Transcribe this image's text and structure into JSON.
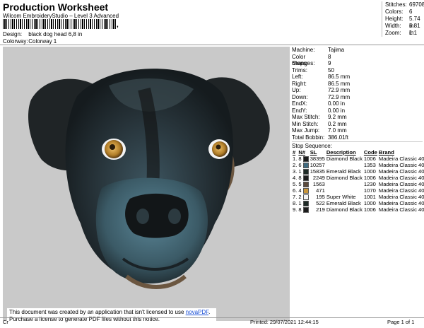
{
  "header": {
    "title": "Production Worksheet",
    "subtitle": "Wilcom EmbroideryStudio – Level 3 Advanced",
    "barcode_suffix": ",",
    "design_label": "Design:",
    "design_value": "black dog head 6,8 in",
    "colorway_label": "Colorway:",
    "colorway_value": "Colorway 1"
  },
  "stats": [
    {
      "label": "Stitches:",
      "value": "69708"
    },
    {
      "label": "Colors:",
      "value": "6"
    },
    {
      "label": "Height:",
      "value": "5.74 in"
    },
    {
      "label": "Width:",
      "value": "6.81 in"
    },
    {
      "label": "Zoom:",
      "value": "1:1"
    }
  ],
  "machine": [
    {
      "label": "Machine:",
      "value": "Tajima"
    },
    {
      "label": "Color changes:",
      "value": "8"
    },
    {
      "label": "Stops:",
      "value": "9"
    },
    {
      "label": "Trims:",
      "value": "50"
    },
    {
      "label": "Left:",
      "value": "86.5 mm"
    },
    {
      "label": "Right:",
      "value": "86.5 mm"
    },
    {
      "label": "Up:",
      "value": "72.9 mm"
    },
    {
      "label": "Down:",
      "value": "72.9 mm"
    },
    {
      "label": "EndX:",
      "value": "0.00 in"
    },
    {
      "label": "EndY:",
      "value": "0.00 in"
    },
    {
      "label": "Max Stitch:",
      "value": "9.2 mm"
    },
    {
      "label": "Min Stitch:",
      "value": "0.2 mm"
    },
    {
      "label": "Max Jump:",
      "value": "7.0 mm"
    },
    {
      "label": "Total Bobbin:",
      "value": "386.01ft"
    }
  ],
  "stop_sequence": {
    "title": "Stop Sequence:",
    "columns": [
      "#",
      "N#",
      "SL",
      "Description",
      "Code",
      "Brand"
    ],
    "rows": [
      {
        "num": "1.",
        "n": "8",
        "color": "#1c1c1c",
        "sl": "38395",
        "desc": "Diamond Black",
        "code": "1006",
        "brand": "Madeira Classic 40"
      },
      {
        "num": "2.",
        "n": "6",
        "color": "#3f6b80",
        "sl": "10257",
        "desc": "",
        "code": "1353",
        "brand": "Madeira Classic 40"
      },
      {
        "num": "3.",
        "n": "1",
        "color": "#1e2a26",
        "sl": "15835",
        "desc": "Emerald Black",
        "code": "1000",
        "brand": "Madeira Classic 40"
      },
      {
        "num": "4.",
        "n": "8",
        "color": "#1c1c1c",
        "sl": "2249",
        "desc": "Diamond Black",
        "code": "1006",
        "brand": "Madeira Classic 40"
      },
      {
        "num": "5.",
        "n": "5",
        "color": "#5b4a3c",
        "sl": "1563",
        "desc": "",
        "code": "1230",
        "brand": "Madeira Classic 40"
      },
      {
        "num": "6.",
        "n": "4",
        "color": "#c9963a",
        "sl": "471",
        "desc": "",
        "code": "1070",
        "brand": "Madeira Classic 40"
      },
      {
        "num": "7.",
        "n": "2",
        "color": "#f4f4f4",
        "sl": "195",
        "desc": "Super White",
        "code": "1001",
        "brand": "Madeira Classic 40"
      },
      {
        "num": "8.",
        "n": "1",
        "color": "#1e2a26",
        "sl": "522",
        "desc": "Emerald Black",
        "code": "1000",
        "brand": "Madeira Classic 40"
      },
      {
        "num": "9.",
        "n": "8",
        "color": "#1c1c1c",
        "sl": "219",
        "desc": "Diamond Black",
        "code": "1006",
        "brand": "Madeira Classic 40"
      }
    ]
  },
  "notice": {
    "line1_pre": "This document was created by an application that isn't licensed to use ",
    "link": "novaPDF",
    "line1_post": ".",
    "line2": "Purchase a license to generate PDF files without this notice."
  },
  "footer": {
    "left": "Cr",
    "printed": "Printed: 29/07/2021 12:44:15",
    "page": "Page 1 of 1"
  }
}
